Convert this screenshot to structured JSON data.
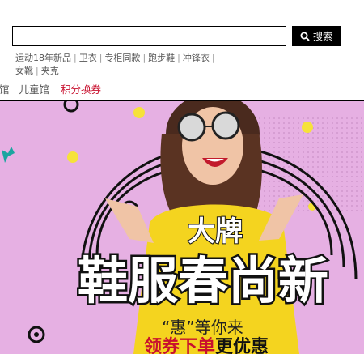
{
  "search": {
    "placeholder": "",
    "button_label": "搜索"
  },
  "hot_words": [
    "运动18年新品",
    "卫衣",
    "专柜同款",
    "跑步鞋",
    "冲锋衣",
    "女靴",
    "夹克"
  ],
  "nav": {
    "items": [
      {
        "label": "馆"
      },
      {
        "label": "儿童馆"
      },
      {
        "label": "积分换券"
      }
    ]
  },
  "banner": {
    "tag_top": "大牌",
    "headline": "鞋服春尚新",
    "sub_quote": "“惠”等你来",
    "promo_red": "领券下单",
    "promo_black": "更优惠"
  },
  "colors": {
    "banner_bg": "#e6b0e3",
    "accent_red": "#c8102e",
    "shirt_yellow": "#f4d41f"
  }
}
